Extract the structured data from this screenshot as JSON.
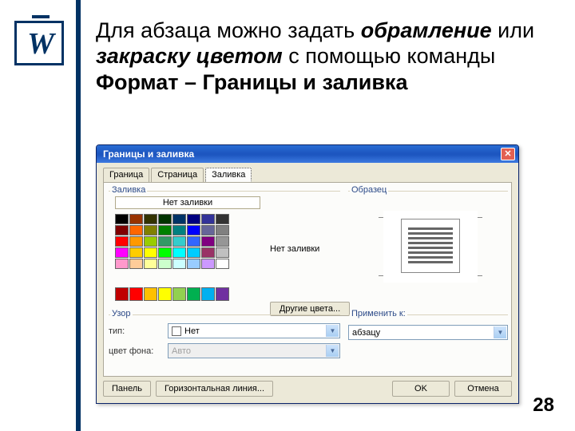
{
  "logo_letter": "W",
  "heading_parts": {
    "p1": "Для абзаца можно задать ",
    "p2_bi": "обрамление",
    "p3": " или ",
    "p4_bi": "закраску цветом",
    "p5": " с помощью команды ",
    "p6_b": "Формат – Границы и заливка"
  },
  "dialog": {
    "title": "Границы и заливка",
    "close": "✕",
    "tabs": [
      "Граница",
      "Страница",
      "Заливка"
    ],
    "active_tab": 2,
    "fill_group": "Заливка",
    "no_fill": "Нет заливки",
    "current_fill": "Нет заливки",
    "more_colors": "Другие цвета...",
    "pattern_group": "Узор",
    "pattern_type_label": "тип:",
    "pattern_type_value": "Нет",
    "pattern_color_label": "цвет фона:",
    "pattern_color_value": "Авто",
    "preview_group": "Образец",
    "apply_group": "Применить к:",
    "apply_value": "абзацу",
    "btn_panel": "Панель",
    "btn_hline": "Горизонтальная линия...",
    "btn_ok": "OK",
    "btn_cancel": "Отмена"
  },
  "palette_colors": [
    "#000000",
    "#993300",
    "#333300",
    "#003300",
    "#003366",
    "#000080",
    "#333399",
    "#333333",
    "#800000",
    "#ff6600",
    "#808000",
    "#008000",
    "#008080",
    "#0000ff",
    "#666699",
    "#808080",
    "#ff0000",
    "#ff9900",
    "#99cc00",
    "#339966",
    "#33cccc",
    "#3366ff",
    "#800080",
    "#969696",
    "#ff00ff",
    "#ffcc00",
    "#ffff00",
    "#00ff00",
    "#00ffff",
    "#00ccff",
    "#993366",
    "#c0c0c0",
    "#ff99cc",
    "#ffcc99",
    "#ffff99",
    "#ccffcc",
    "#ccffff",
    "#99ccff",
    "#cc99ff",
    "#ffffff"
  ],
  "standard_colors": [
    "#c00000",
    "#ff0000",
    "#ffc000",
    "#ffff00",
    "#92d050",
    "#00b050",
    "#00b0f0",
    "#7030a0"
  ],
  "slide_number": "28"
}
